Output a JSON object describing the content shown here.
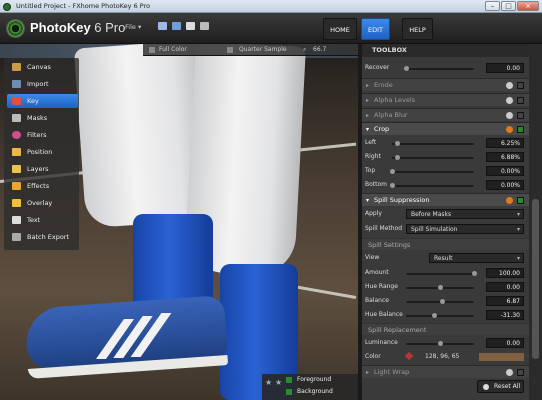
{
  "window": {
    "title": "Untitled Project - FXhome PhotoKey 6 Pro"
  },
  "brand": {
    "name": "PhotoKey",
    "version": "6 Pro"
  },
  "menu": {
    "file": "File"
  },
  "nav": {
    "home": "HOME",
    "edit": "EDIT",
    "help": "HELP"
  },
  "infobar": {
    "mode": "Full Color",
    "sampling": "Quarter Sample",
    "zoom": "66.7"
  },
  "sidebar": {
    "items": [
      {
        "label": "Canvas",
        "icon": "canvas-icon",
        "color": "#c99a4a"
      },
      {
        "label": "Import",
        "icon": "import-icon",
        "color": "#6f8db3"
      },
      {
        "label": "Key",
        "icon": "key-icon",
        "color": "#e05040"
      },
      {
        "label": "Masks",
        "icon": "masks-icon",
        "color": "#bbbbbb"
      },
      {
        "label": "Filters",
        "icon": "filters-icon",
        "color": "#d44d8f"
      },
      {
        "label": "Position",
        "icon": "position-icon",
        "color": "#e8b94a"
      },
      {
        "label": "Layers",
        "icon": "layers-icon",
        "color": "#e8c450"
      },
      {
        "label": "Effects",
        "icon": "effects-icon",
        "color": "#e8a530"
      },
      {
        "label": "Overlay",
        "icon": "overlay-icon",
        "color": "#f0c040"
      },
      {
        "label": "Text",
        "icon": "text-icon",
        "color": "#dddddd"
      },
      {
        "label": "Batch Export",
        "icon": "batch-export-icon",
        "color": "#aaaaaa"
      }
    ],
    "active": "Key"
  },
  "layers_toggle": {
    "foreground": "Foreground",
    "background": "Background"
  },
  "toolbox": {
    "title": "TOOLBOX",
    "recover": {
      "label": "Recover",
      "value": "0.00",
      "fraction": 0.0
    },
    "sections": {
      "erode": "Erode",
      "alpha_levels": "Alpha Levels",
      "alpha_blur": "Alpha Blur",
      "crop": "Crop",
      "spill_suppression": "Spill Suppression",
      "light_wrap": "Light Wrap"
    },
    "crop": [
      {
        "label": "Left",
        "value": "6.25%",
        "fraction": 0.0625
      },
      {
        "label": "Right",
        "value": "6.88%",
        "fraction": 0.0688
      },
      {
        "label": "Top",
        "value": "0.00%",
        "fraction": 0.0
      },
      {
        "label": "Bottom",
        "value": "0.00%",
        "fraction": 0.0
      }
    ],
    "spill": {
      "apply_label": "Apply",
      "apply_value": "Before Masks",
      "method_label": "Spill Method",
      "method_value": "Spill Simulation",
      "settings_title": "Spill Settings",
      "view_label": "View",
      "view_value": "Result",
      "amount": {
        "label": "Amount",
        "value": "100.00",
        "fraction": 1.0
      },
      "hue_range": {
        "label": "Hue Range",
        "value": "0.00",
        "fraction": 0.5
      },
      "balance": {
        "label": "Balance",
        "value": "6.87",
        "fraction": 0.53
      },
      "hue_balance": {
        "label": "Hue Balance",
        "value": "-31.30",
        "fraction": 0.42
      },
      "replacement_title": "Spill Replacement",
      "luminance": {
        "label": "Luminance",
        "value": "0.00",
        "fraction": 0.5
      },
      "color_label": "Color",
      "color_rgb": "128, 96, 65",
      "color_hex": "#806041"
    },
    "reset_all": "Reset All"
  }
}
